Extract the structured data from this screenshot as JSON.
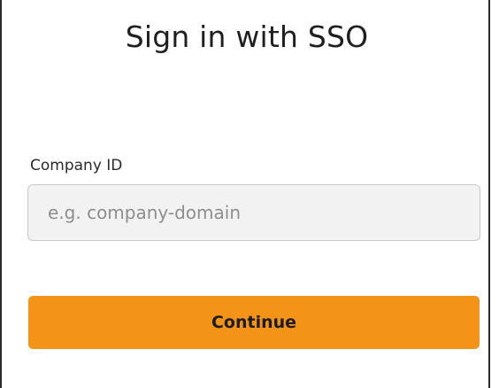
{
  "form": {
    "title": "Sign in with SSO",
    "company_id_label": "Company ID",
    "company_id_value": "",
    "company_id_placeholder": "e.g. company-domain",
    "continue_label": "Continue"
  },
  "colors": {
    "accent": "#f39419",
    "input_background": "#f2f2f2",
    "input_border": "#c9c9c9"
  }
}
